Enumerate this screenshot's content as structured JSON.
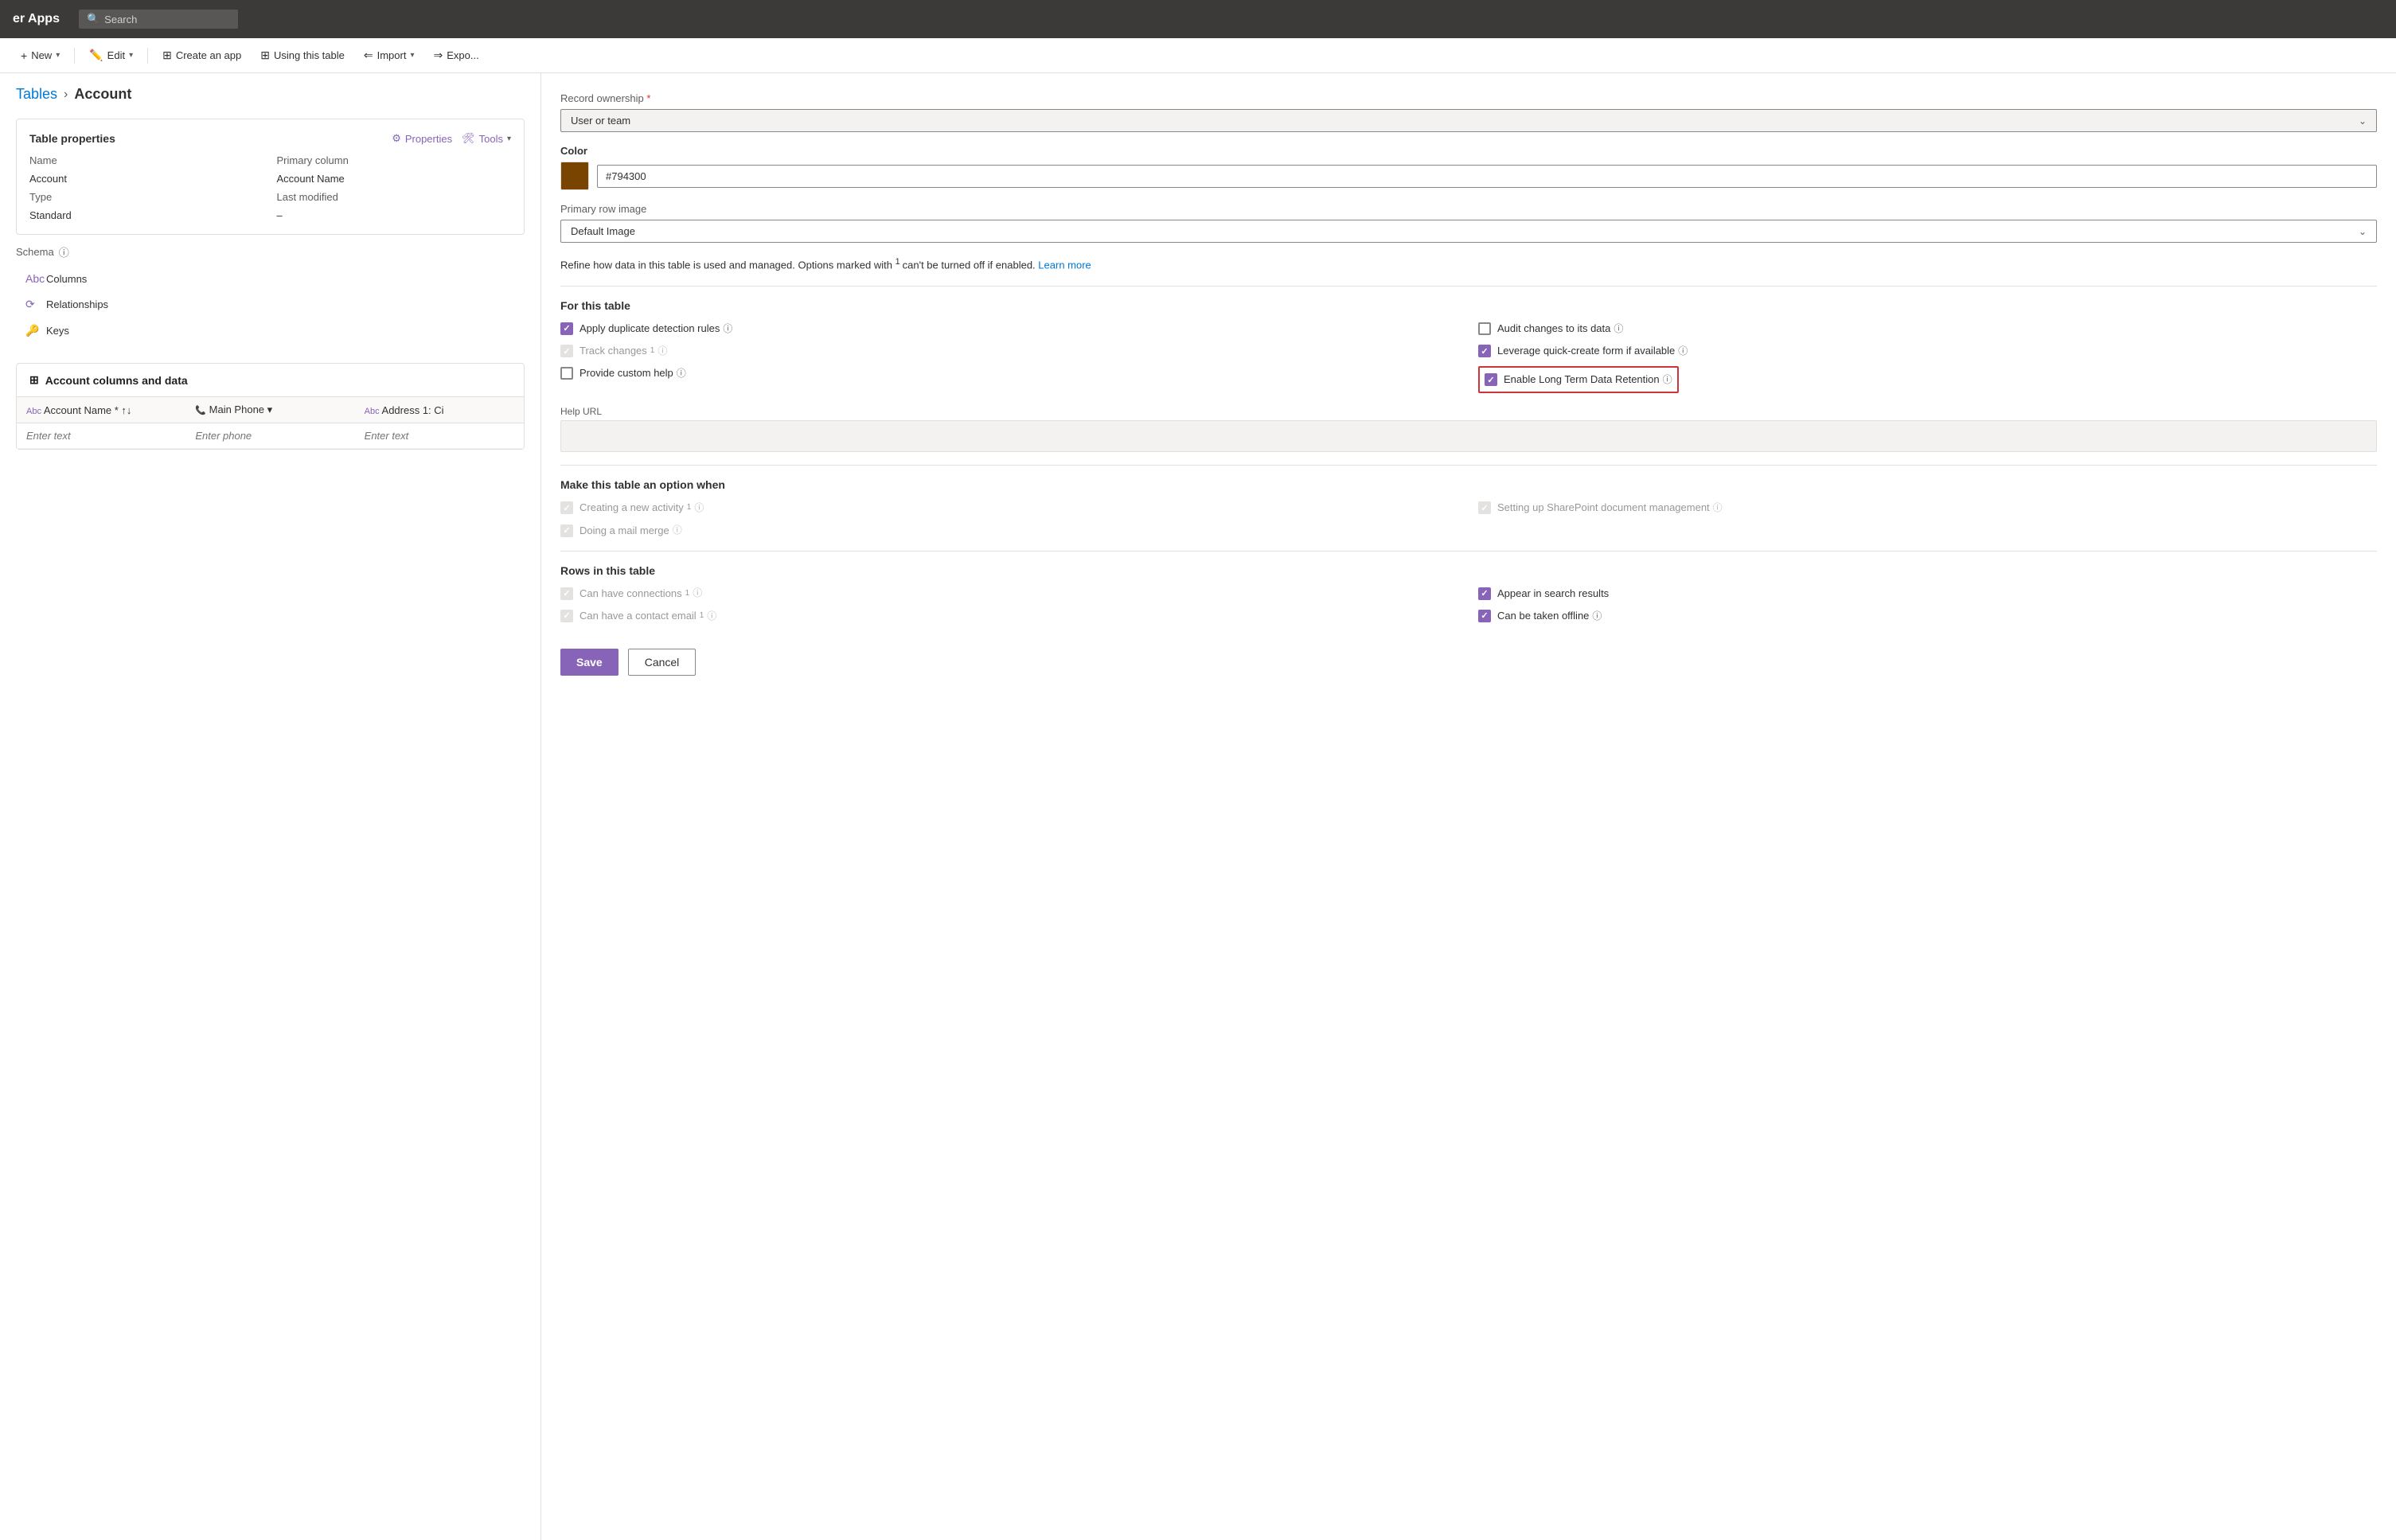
{
  "topbar": {
    "title": "er Apps",
    "search_placeholder": "Search"
  },
  "toolbar": {
    "new_label": "New",
    "edit_label": "Edit",
    "create_app_label": "Create an app",
    "using_table_label": "Using this table",
    "import_label": "Import",
    "export_label": "Expo..."
  },
  "breadcrumb": {
    "tables_label": "Tables",
    "separator": "›",
    "current": "Account"
  },
  "table_properties": {
    "title": "Table properties",
    "properties_btn": "Properties",
    "tools_btn": "Tools",
    "name_label": "Name",
    "name_value": "Account",
    "primary_column_label": "Primary column",
    "primary_column_value": "Account Name",
    "type_label": "Type",
    "type_value": "Last modified",
    "standard_label": "Standard",
    "standard_value": "–"
  },
  "schema": {
    "title": "Schema",
    "info_icon": "ⓘ",
    "items": [
      {
        "id": "columns",
        "icon": "Abc",
        "label": "Columns"
      },
      {
        "id": "relationships",
        "icon": "⟳",
        "label": "Relationships"
      },
      {
        "id": "keys",
        "icon": "🔑",
        "label": "Keys"
      }
    ]
  },
  "data_section": {
    "title": "Account columns and data",
    "columns": [
      {
        "id": "account-name",
        "icon": "Abc",
        "label": "Account Name",
        "required": true,
        "sortable": true
      },
      {
        "id": "main-phone",
        "icon": "📞",
        "label": "Main Phone",
        "dropdown": true
      },
      {
        "id": "address",
        "icon": "Abc",
        "label": "Address 1: Ci"
      }
    ],
    "placeholder_text": "Enter text",
    "placeholder_phone": "Enter phone"
  },
  "right_panel": {
    "record_ownership_label": "Record ownership",
    "record_ownership_required": true,
    "record_ownership_value": "User or team",
    "color_label": "Color",
    "color_hex": "#794300",
    "primary_row_image_label": "Primary row image",
    "primary_row_image_value": "Default Image",
    "refine_text": "Refine how data in this table is used and managed. Options marked with",
    "refine_superscript": "1",
    "refine_text2": "can't be turned off if enabled.",
    "learn_more": "Learn more",
    "for_this_table_title": "For this table",
    "checkboxes": [
      {
        "id": "apply-duplicate",
        "checked": true,
        "disabled": false,
        "label": "Apply duplicate detection rules",
        "info": true,
        "superscript": false
      },
      {
        "id": "audit-changes",
        "checked": false,
        "disabled": false,
        "label": "Audit changes to its data",
        "info": true,
        "superscript": false
      },
      {
        "id": "track-changes",
        "checked": false,
        "disabled": true,
        "label": "Track changes",
        "info": true,
        "superscript": "1"
      },
      {
        "id": "leverage-quick-create",
        "checked": true,
        "disabled": false,
        "label": "Leverage quick-create form if available",
        "info": true,
        "superscript": false
      },
      {
        "id": "provide-custom-help",
        "checked": false,
        "disabled": false,
        "label": "Provide custom help",
        "info": true,
        "superscript": false
      },
      {
        "id": "enable-long-term",
        "checked": true,
        "disabled": false,
        "label": "Enable Long Term Data Retention",
        "info": true,
        "superscript": false,
        "highlighted": true
      }
    ],
    "help_url_label": "Help URL",
    "make_option_title": "Make this table an option when",
    "make_option_checkboxes": [
      {
        "id": "creating-activity",
        "checked": false,
        "disabled": true,
        "label": "Creating a new activity",
        "superscript": "1",
        "info": true
      },
      {
        "id": "sharepoint",
        "checked": false,
        "disabled": true,
        "label": "Setting up SharePoint document management",
        "info": true
      },
      {
        "id": "mail-merge",
        "checked": false,
        "disabled": true,
        "label": "Doing a mail merge",
        "info": true
      }
    ],
    "rows_in_table_title": "Rows in this table",
    "rows_checkboxes": [
      {
        "id": "connections",
        "checked": false,
        "disabled": true,
        "label": "Can have connections",
        "superscript": "1",
        "info": true
      },
      {
        "id": "appear-search",
        "checked": true,
        "disabled": false,
        "label": "Appear in search results",
        "info": false
      },
      {
        "id": "contact-email",
        "checked": false,
        "disabled": true,
        "label": "Can have a contact email",
        "superscript": "1",
        "info": true
      },
      {
        "id": "taken-offline",
        "checked": true,
        "disabled": false,
        "label": "Can be taken offline",
        "info": true
      }
    ],
    "save_label": "Save",
    "cancel_label": "Cancel"
  }
}
